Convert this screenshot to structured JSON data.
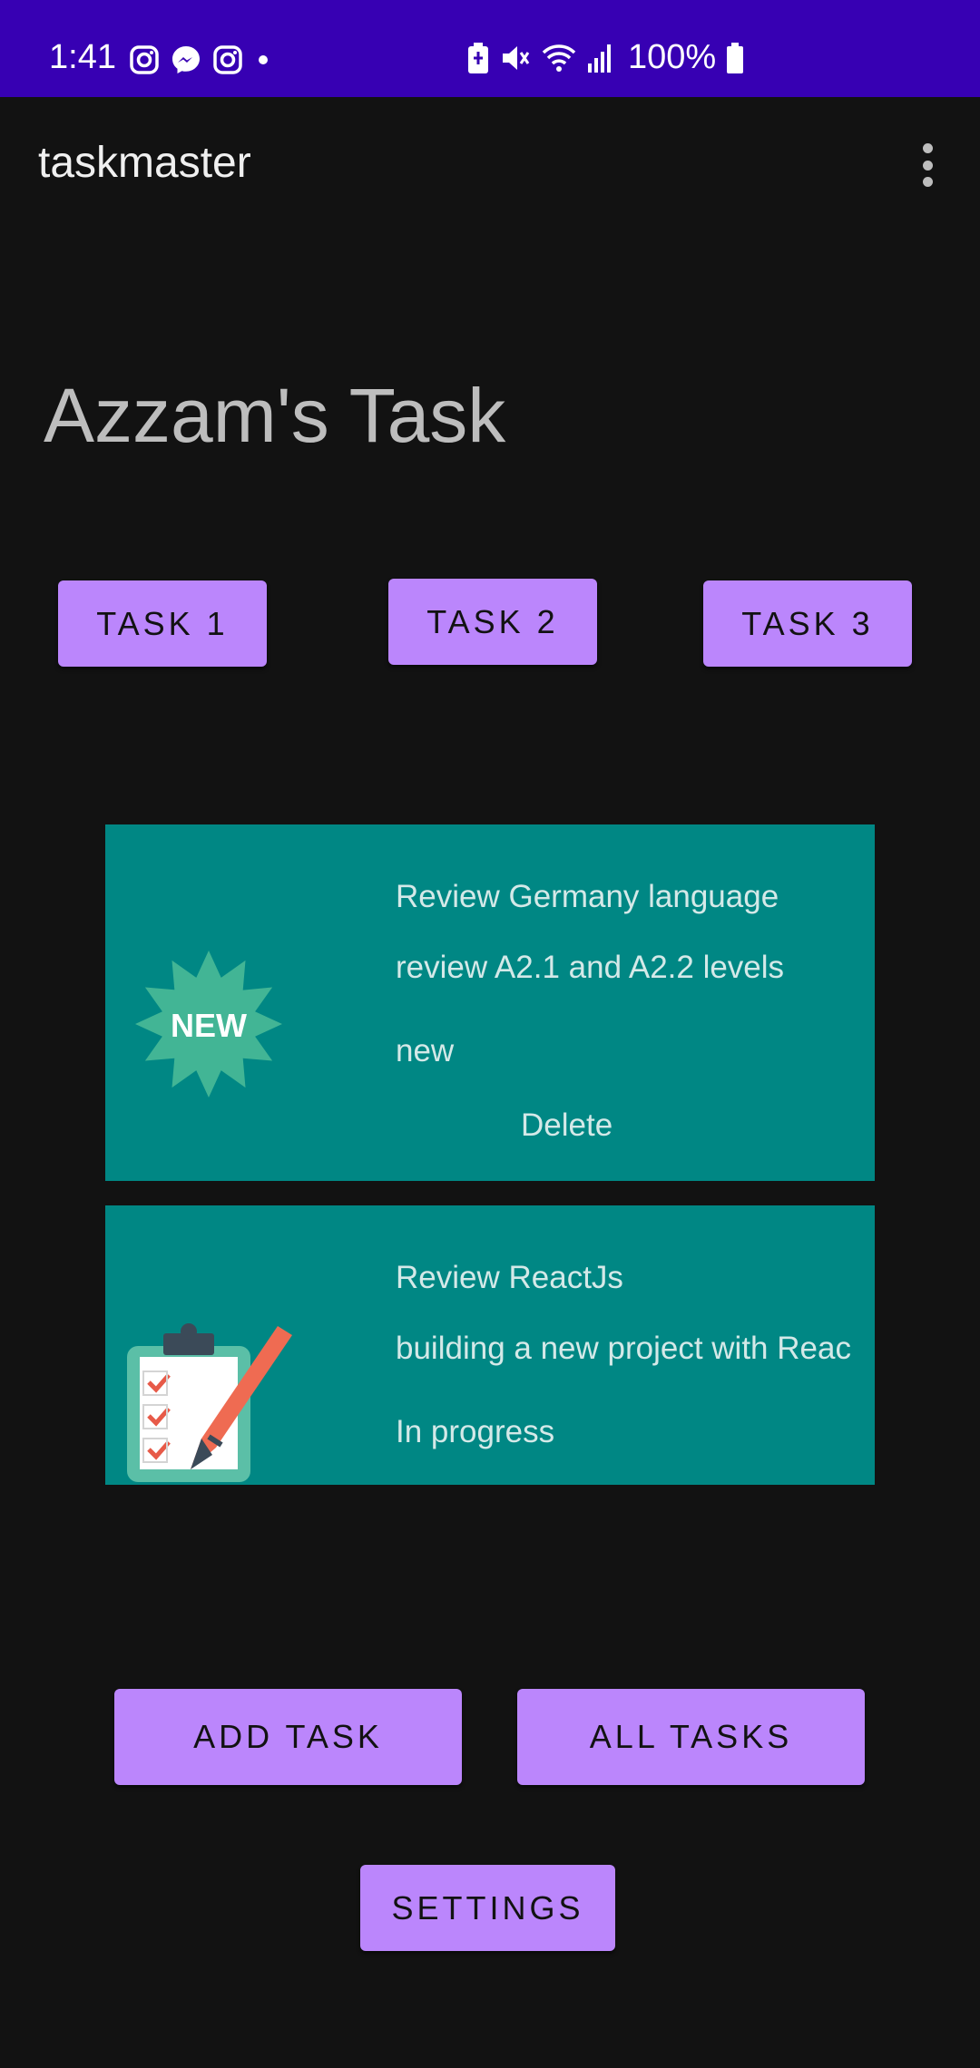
{
  "status_bar": {
    "time": "1:41",
    "battery": "100%",
    "left_icons": [
      "instagram-icon",
      "messenger-icon",
      "instagram-icon",
      "dot-icon"
    ],
    "right_icons": [
      "battery-saver-icon",
      "mute-icon",
      "wifi-icon",
      "signal-icon",
      "battery-icon"
    ]
  },
  "app_bar": {
    "title": "taskmaster",
    "menu_icon": "overflow-menu-icon"
  },
  "heading": "Azzam's Task",
  "task_buttons": [
    "TASK 1",
    "TASK 2",
    "TASK 3"
  ],
  "tasks": [
    {
      "title": "Review Germany language",
      "body": "review A2.1 and A2.2 levels",
      "state": "new",
      "delete_label": "Delete",
      "icon": "new-badge-icon",
      "badge_text": "NEW"
    },
    {
      "title": "Review ReactJs",
      "body": "building a new project with Reac",
      "state": "In progress",
      "icon": "clipboard-checklist-icon"
    }
  ],
  "actions": {
    "add_task": "ADD TASK",
    "all_tasks": "ALL TASKS",
    "settings": "SETTINGS"
  },
  "colors": {
    "status_bar": "#3700b3",
    "background": "#121212",
    "button": "#bb86fc",
    "card": "#008784"
  }
}
